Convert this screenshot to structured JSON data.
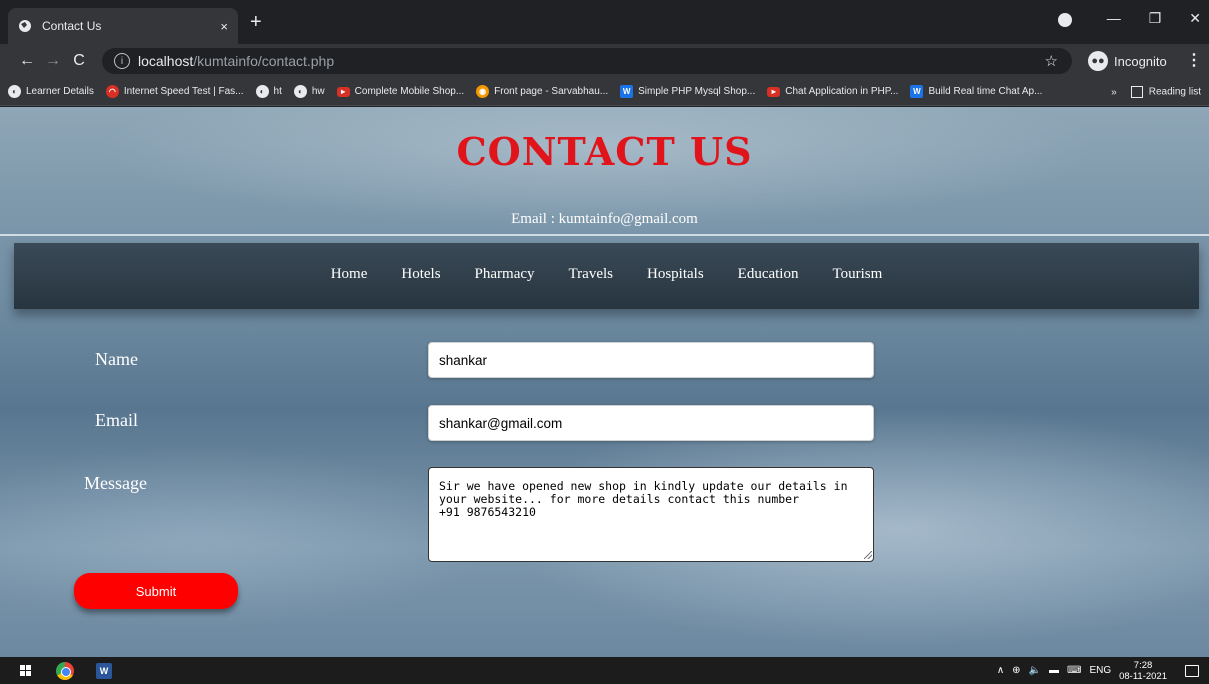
{
  "browser": {
    "tab_title": "Contact Us",
    "tab_close": "×",
    "new_tab": "+",
    "url_host": "localhost",
    "url_path": "/kumtainfo/contact.php",
    "incognito_label": "Incognito",
    "window_controls": [
      "—",
      "❐",
      "✕"
    ],
    "bookmarks": [
      {
        "label": "Learner Details",
        "icon": "globe-icon"
      },
      {
        "label": "Internet Speed Test | Fas...",
        "icon": "speedtest-icon"
      },
      {
        "label": "ht",
        "icon": "globe-icon"
      },
      {
        "label": "hw",
        "icon": "globe-icon"
      },
      {
        "label": "Complete Mobile Shop...",
        "icon": "youtube-icon"
      },
      {
        "label": "Front page - Sarvabhau...",
        "icon": "site-icon"
      },
      {
        "label": "Simple PHP Mysql Shop...",
        "icon": "word-icon"
      },
      {
        "label": "Chat Application in PHP...",
        "icon": "youtube-icon"
      },
      {
        "label": "Build Real time Chat Ap...",
        "icon": "word-icon"
      }
    ],
    "more_bookmarks": "»",
    "reading_list": "Reading list"
  },
  "header": {
    "title": "CONTACT US",
    "email": "Email : kumtainfo@gmail.com"
  },
  "nav": [
    "Home",
    "Hotels",
    "Pharmacy",
    "Travels",
    "Hospitals",
    "Education",
    "Tourism"
  ],
  "form": {
    "name_label": "Name",
    "name_value": "shankar",
    "email_label": "Email",
    "email_value": "shankar@gmail.com",
    "message_label": "Message",
    "message_value": "Sir we have opened new shop in kindly update our details in\nyour website... for more details contact this number\n+91 9876543210",
    "submit_label": "Submit"
  },
  "taskbar": {
    "language": "ENG",
    "time": "7:28",
    "date": "08-11-2021"
  },
  "colors": {
    "title_red": "#e0141a",
    "submit_red": "#ff0000",
    "navbar": "#2d3b46"
  }
}
